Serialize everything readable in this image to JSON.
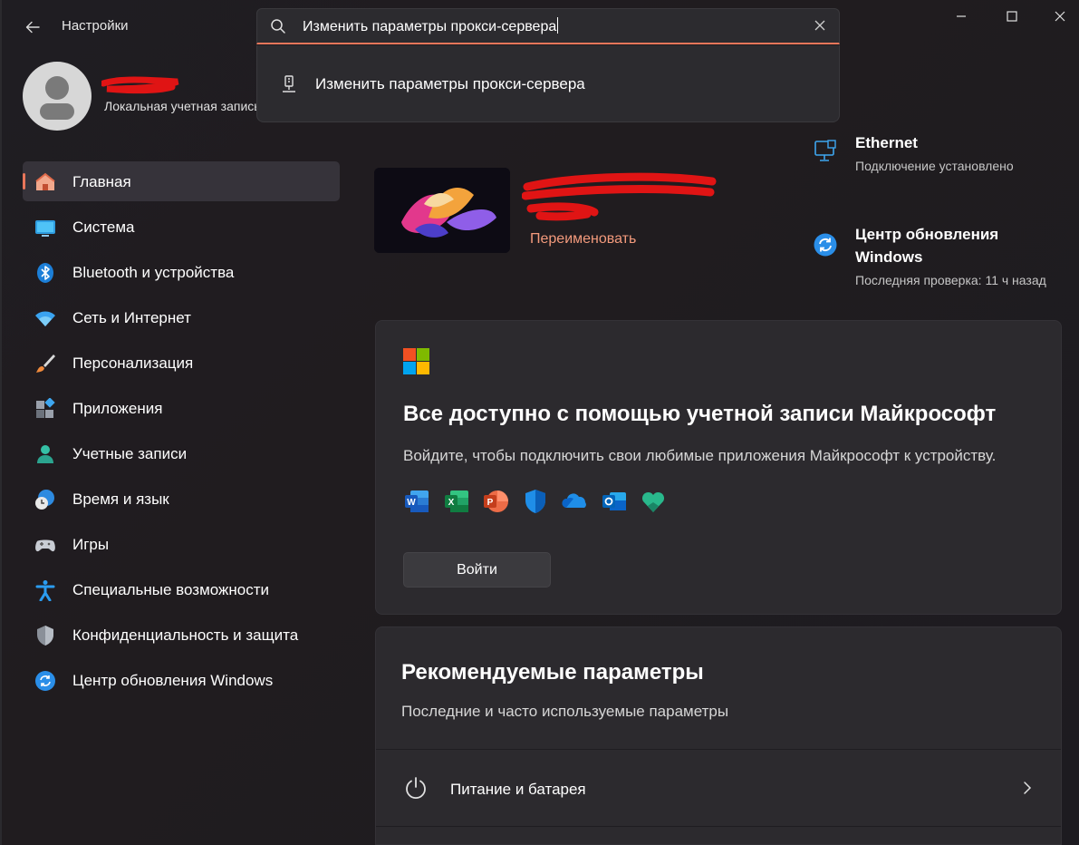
{
  "window": {
    "title": "Настройки"
  },
  "search": {
    "value": "Изменить параметры прокси-сервера",
    "suggestions": [
      {
        "label": "Изменить параметры прокси-сервера",
        "icon": "proxy-network-icon"
      }
    ]
  },
  "profile": {
    "account_type": "Локальная учетная запись"
  },
  "sidebar": {
    "items": [
      {
        "label": "Главная",
        "icon": "home-icon",
        "active": true
      },
      {
        "label": "Система",
        "icon": "system-display-icon"
      },
      {
        "label": "Bluetooth и устройства",
        "icon": "bluetooth-icon"
      },
      {
        "label": "Сеть и Интернет",
        "icon": "wifi-icon"
      },
      {
        "label": "Персонализация",
        "icon": "brush-icon"
      },
      {
        "label": "Приложения",
        "icon": "apps-icon"
      },
      {
        "label": "Учетные записи",
        "icon": "account-icon"
      },
      {
        "label": "Время и язык",
        "icon": "clock-globe-icon"
      },
      {
        "label": "Игры",
        "icon": "gamepad-icon"
      },
      {
        "label": "Специальные возможности",
        "icon": "accessibility-icon"
      },
      {
        "label": "Конфиденциальность и защита",
        "icon": "shield-icon"
      },
      {
        "label": "Центр обновления Windows",
        "icon": "update-icon"
      }
    ]
  },
  "device": {
    "rename_label": "Переименовать"
  },
  "status": {
    "network": {
      "title": "Ethernet",
      "subtitle": "Подключение установлено"
    },
    "update": {
      "title": "Центр обновления Windows",
      "subtitle": "Последняя проверка: 11 ч назад"
    }
  },
  "ms_account_card": {
    "title": "Все доступно с помощью учетной записи Майкрософт",
    "description": "Войдите, чтобы подключить свои любимые приложения Майкрософт к устройству.",
    "apps": [
      "word-icon",
      "excel-icon",
      "powerpoint-icon",
      "defender-icon",
      "onedrive-icon",
      "outlook-icon",
      "family-icon"
    ],
    "signin_label": "Войти"
  },
  "recommended": {
    "title": "Рекомендуемые параметры",
    "subtitle": "Последние и часто используемые параметры",
    "items": [
      {
        "label": "Питание и батарея",
        "icon": "power-icon"
      }
    ]
  },
  "colors": {
    "accent": "#e8765a",
    "link": "#f39a7c",
    "background": "#1f1d22",
    "card": "#2c2a2e"
  }
}
